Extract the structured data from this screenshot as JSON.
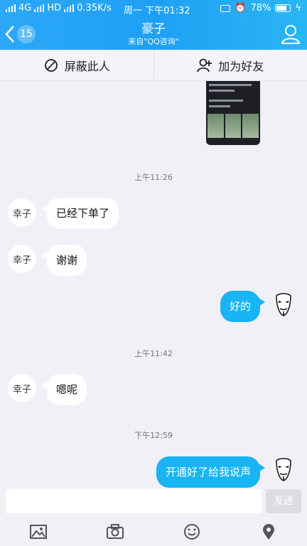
{
  "status_bar": {
    "network": "4G",
    "hd": "HD",
    "speed": "0.35K/s",
    "datetime": "周一 下午01:32",
    "battery": "78%"
  },
  "header": {
    "back_count": "15",
    "title": "豪子",
    "subtitle": "来自\"QQ咨询\"",
    "accent_color": "#1ea0f5"
  },
  "actions": {
    "block_label": "屏蔽此人",
    "add_friend_label": "加为好友"
  },
  "messages": [
    {
      "time": "上午11:26"
    },
    {
      "from": "other",
      "text": "已经下单了"
    },
    {
      "from": "other",
      "text": "谢谢"
    },
    {
      "from": "self",
      "text": "好的"
    },
    {
      "time": "上午11:42"
    },
    {
      "from": "other",
      "text": "嗯呢"
    },
    {
      "time": "下午12:59"
    },
    {
      "from": "self",
      "text": "开通好了给我说声"
    }
  ],
  "composer": {
    "send_label": "发送"
  },
  "avatar_text": "幸子"
}
